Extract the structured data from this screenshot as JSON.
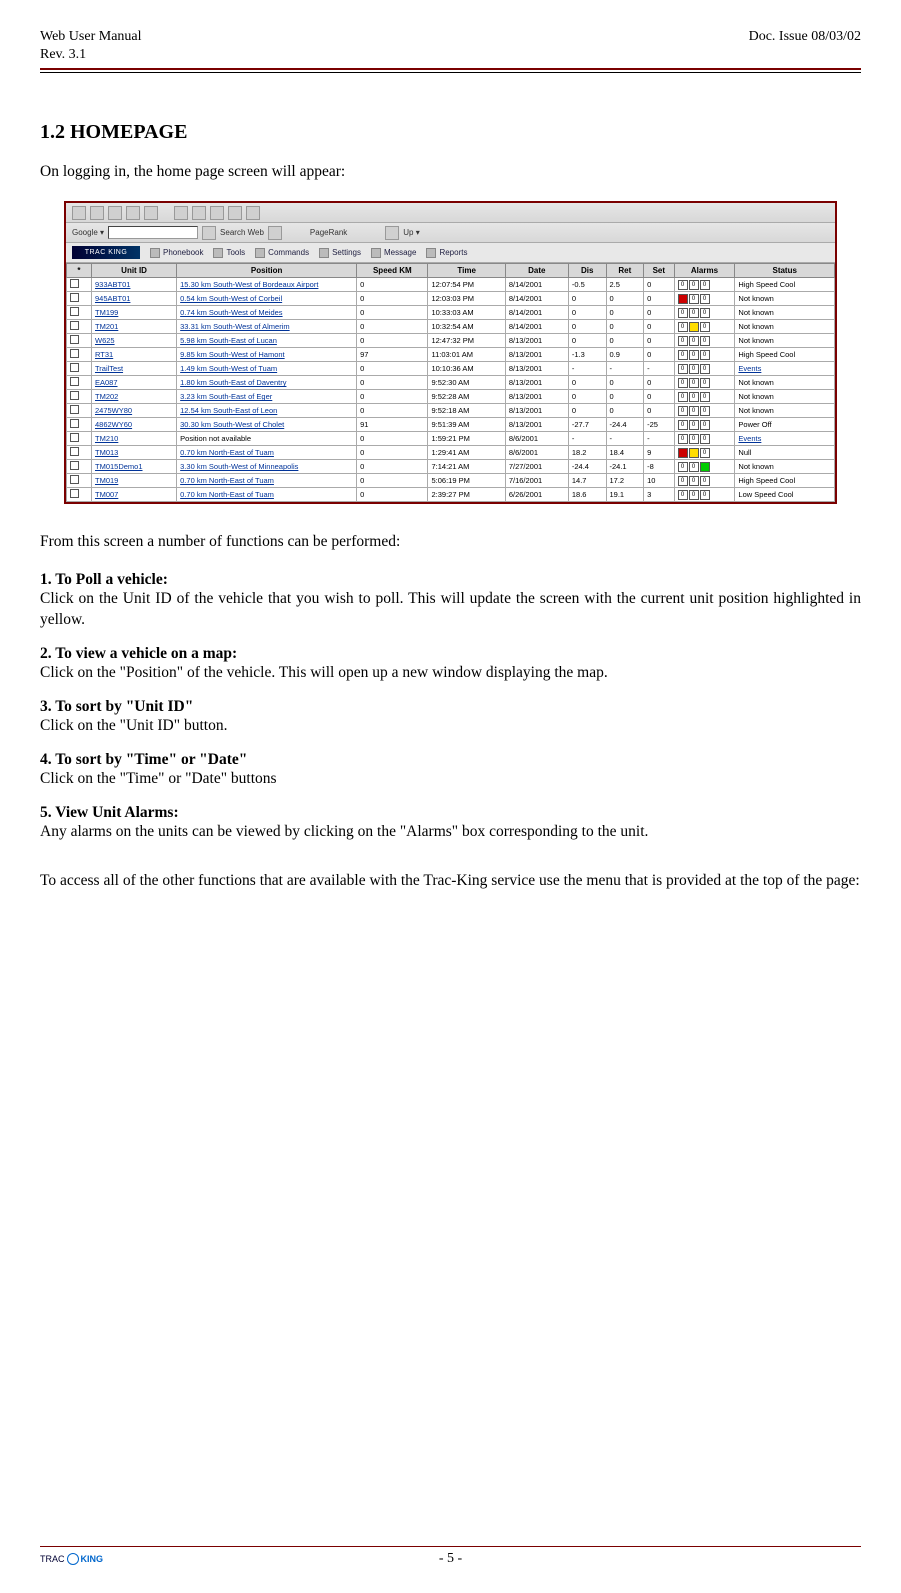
{
  "header": {
    "left_line1": "Web User Manual",
    "left_line2": "Rev. 3.1",
    "right_line1": "Doc. Issue 08/03/02"
  },
  "section": {
    "number": "1.2",
    "title": "HOMEPAGE",
    "intro": "On logging in, the home page screen will appear:",
    "after_shot": "From this screen a number of functions can be performed:",
    "closing": "To access all of the other functions that are available with the Trac-King service use the menu that is provided at the top of the page:"
  },
  "items": [
    {
      "title": "1. To Poll a vehicle:",
      "text": "Click on the Unit ID of the vehicle that you wish to poll.  This will update the screen with the current unit position highlighted in yellow."
    },
    {
      "title": "2. To view a vehicle on a map:",
      "title_suffix": ":",
      "text": "Click on the \"Position\" of the vehicle.  This will open up a new window displaying the map."
    },
    {
      "title": "3. To sort by \"Unit ID\"",
      "text": "Click on the \"Unit ID\" button."
    },
    {
      "title": "4. To sort by \"Time\" or \"Date\"",
      "text": "Click on the \"Time\" or \"Date\" buttons"
    },
    {
      "title": "5. View Unit Alarms:",
      "text": "Any alarms on the units can be viewed by clicking on the \"Alarms\" box corresponding to the unit."
    }
  ],
  "screenshot": {
    "toolbar": {
      "google_label": "Google ▾",
      "search_web": "Search Web",
      "pagerank": "PageRank",
      "up": "Up ▾"
    },
    "menu": {
      "logo": "TRAC KING",
      "items": [
        "Phonebook",
        "Tools",
        "Commands",
        "Settings",
        "Message",
        "Reports"
      ]
    },
    "columns": [
      "*",
      "Unit ID",
      "Position",
      "Speed KM",
      "Time",
      "Date",
      "Dis",
      "Ret",
      "Set",
      "Alarms",
      "Status"
    ],
    "rows": [
      {
        "unit": "933ABT01",
        "pos": "15.30 km South-West of Bordeaux Airport",
        "spd": "0",
        "time": "12:07:54 PM",
        "date": "8/14/2001",
        "dis": "-0.5",
        "ret": "2.5",
        "set": "0",
        "alarms": [
          "0",
          "0",
          "0"
        ],
        "status": "High Speed Cool"
      },
      {
        "unit": "945ABT01",
        "pos": "0.54 km South-West of Corbeil",
        "spd": "0",
        "time": "12:03:03 PM",
        "date": "8/14/2001",
        "dis": "0",
        "ret": "0",
        "set": "0",
        "alarms": [
          "R",
          "0",
          "0"
        ],
        "status": "Not known"
      },
      {
        "unit": "TM199",
        "pos": "0.74 km South-West of Meides",
        "spd": "0",
        "time": "10:33:03 AM",
        "date": "8/14/2001",
        "dis": "0",
        "ret": "0",
        "set": "0",
        "alarms": [
          "0",
          "0",
          "0"
        ],
        "status": "Not known"
      },
      {
        "unit": "TM201",
        "pos": "33.31 km South-West of Almerim",
        "spd": "0",
        "time": "10:32:54 AM",
        "date": "8/14/2001",
        "dis": "0",
        "ret": "0",
        "set": "0",
        "alarms": [
          "0",
          "Y",
          "0"
        ],
        "status": "Not known"
      },
      {
        "unit": "W625",
        "pos": "5.98 km South-East of Lucan",
        "spd": "0",
        "time": "12:47:32 PM",
        "date": "8/13/2001",
        "dis": "0",
        "ret": "0",
        "set": "0",
        "alarms": [
          "0",
          "0",
          "0"
        ],
        "status": "Not known"
      },
      {
        "unit": "RT31",
        "pos": "9.85 km South-West of Hamont",
        "spd": "97",
        "time": "11:03:01 AM",
        "date": "8/13/2001",
        "dis": "-1.3",
        "ret": "0.9",
        "set": "0",
        "alarms": [
          "0",
          "0",
          "0"
        ],
        "status": "High Speed Cool"
      },
      {
        "unit": "TrailTest",
        "pos": "1.49 km South-West of Tuam",
        "spd": "0",
        "time": "10:10:36 AM",
        "date": "8/13/2001",
        "dis": "-",
        "ret": "-",
        "set": "-",
        "alarms": [
          "0",
          "0",
          "0"
        ],
        "status": "Events"
      },
      {
        "unit": "EA087",
        "pos": "1.80 km South-East of Daventry",
        "spd": "0",
        "time": "9:52:30 AM",
        "date": "8/13/2001",
        "dis": "0",
        "ret": "0",
        "set": "0",
        "alarms": [
          "0",
          "0",
          "0"
        ],
        "status": "Not known"
      },
      {
        "unit": "TM202",
        "pos": "3.23 km South-East of Eger",
        "spd": "0",
        "time": "9:52:28 AM",
        "date": "8/13/2001",
        "dis": "0",
        "ret": "0",
        "set": "0",
        "alarms": [
          "0",
          "0",
          "0"
        ],
        "status": "Not known"
      },
      {
        "unit": "2475WY80",
        "pos": "12.54 km South-East of Leon",
        "spd": "0",
        "time": "9:52:18 AM",
        "date": "8/13/2001",
        "dis": "0",
        "ret": "0",
        "set": "0",
        "alarms": [
          "0",
          "0",
          "0"
        ],
        "status": "Not known"
      },
      {
        "unit": "4862WY60",
        "pos": "30.30 km South-West of Cholet",
        "spd": "91",
        "time": "9:51:39 AM",
        "date": "8/13/2001",
        "dis": "-27.7",
        "ret": "-24.4",
        "set": "-25",
        "alarms": [
          "0",
          "0",
          "0"
        ],
        "status": "Power Off"
      },
      {
        "unit": "TM210",
        "pos_plain": "Position not available",
        "spd": "0",
        "time": "1:59:21 PM",
        "date": "8/6/2001",
        "dis": "-",
        "ret": "-",
        "set": "-",
        "alarms": [
          "0",
          "0",
          "0"
        ],
        "status": "Events"
      },
      {
        "unit": "TM013",
        "pos": "0.70 km North-East of Tuam",
        "spd": "0",
        "time": "1:29:41 AM",
        "date": "8/6/2001",
        "dis": "18.2",
        "ret": "18.4",
        "set": "9",
        "alarms": [
          "R",
          "Y",
          "0"
        ],
        "status": "Null"
      },
      {
        "unit": "TM015Demo1",
        "pos": "3.30 km South-West of Minneapolis",
        "spd": "0",
        "time": "7:14:21 AM",
        "date": "7/27/2001",
        "dis": "-24.4",
        "ret": "-24.1",
        "set": "-8",
        "alarms": [
          "0",
          "0",
          "G"
        ],
        "status": "Not known"
      },
      {
        "unit": "TM019",
        "pos": "0.70 km North-East of Tuam",
        "spd": "0",
        "time": "5:06:19 PM",
        "date": "7/16/2001",
        "dis": "14.7",
        "ret": "17.2",
        "set": "10",
        "alarms": [
          "0",
          "0",
          "0"
        ],
        "status": "High Speed Cool"
      },
      {
        "unit": "TM007",
        "pos": "0.70 km North-East of Tuam",
        "spd": "0",
        "time": "2:39:27 PM",
        "date": "6/26/2001",
        "dis": "18.6",
        "ret": "19.1",
        "set": "3",
        "alarms": [
          "0",
          "0",
          "0"
        ],
        "status": "Low Speed Cool"
      }
    ]
  },
  "footer": {
    "page": "- 5 -",
    "logo": "TRAC KING"
  }
}
